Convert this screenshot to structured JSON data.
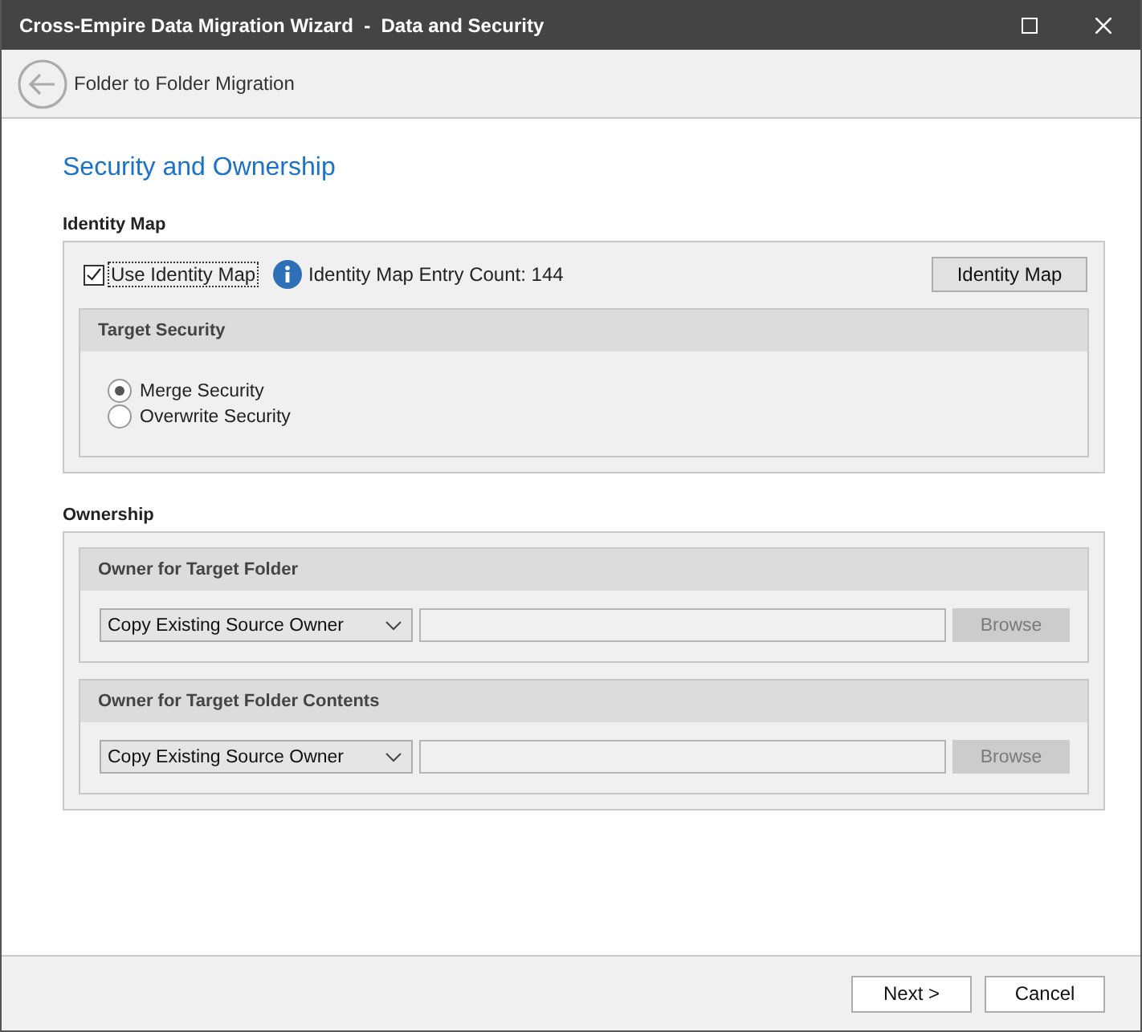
{
  "window": {
    "title": "Cross-Empire Data Migration Wizard  -  Data and Security"
  },
  "header": {
    "title": "Folder to Folder Migration"
  },
  "page_title": "Security and Ownership",
  "identity_map": {
    "label": "Identity Map",
    "use_identity_map": {
      "label": "Use Identity Map",
      "checked": true
    },
    "entry_count": "Identity Map Entry Count: 144",
    "button": "Identity Map",
    "target_security": {
      "title": "Target Security",
      "options": [
        {
          "label": "Merge Security",
          "selected": true
        },
        {
          "label": "Overwrite Security",
          "selected": false
        }
      ]
    }
  },
  "ownership": {
    "label": "Ownership",
    "panels": [
      {
        "title": "Owner for Target Folder",
        "owner": "Copy Existing Source Owner",
        "browse": {
          "label": "Browse",
          "disabled": true
        }
      },
      {
        "title": "Owner for Target Folder Contents",
        "owner": "Copy Existing Source Owner",
        "browse": {
          "label": "Browse",
          "disabled": true
        }
      }
    ]
  },
  "footer": {
    "buttons": [
      "Next >",
      "Cancel"
    ]
  }
}
